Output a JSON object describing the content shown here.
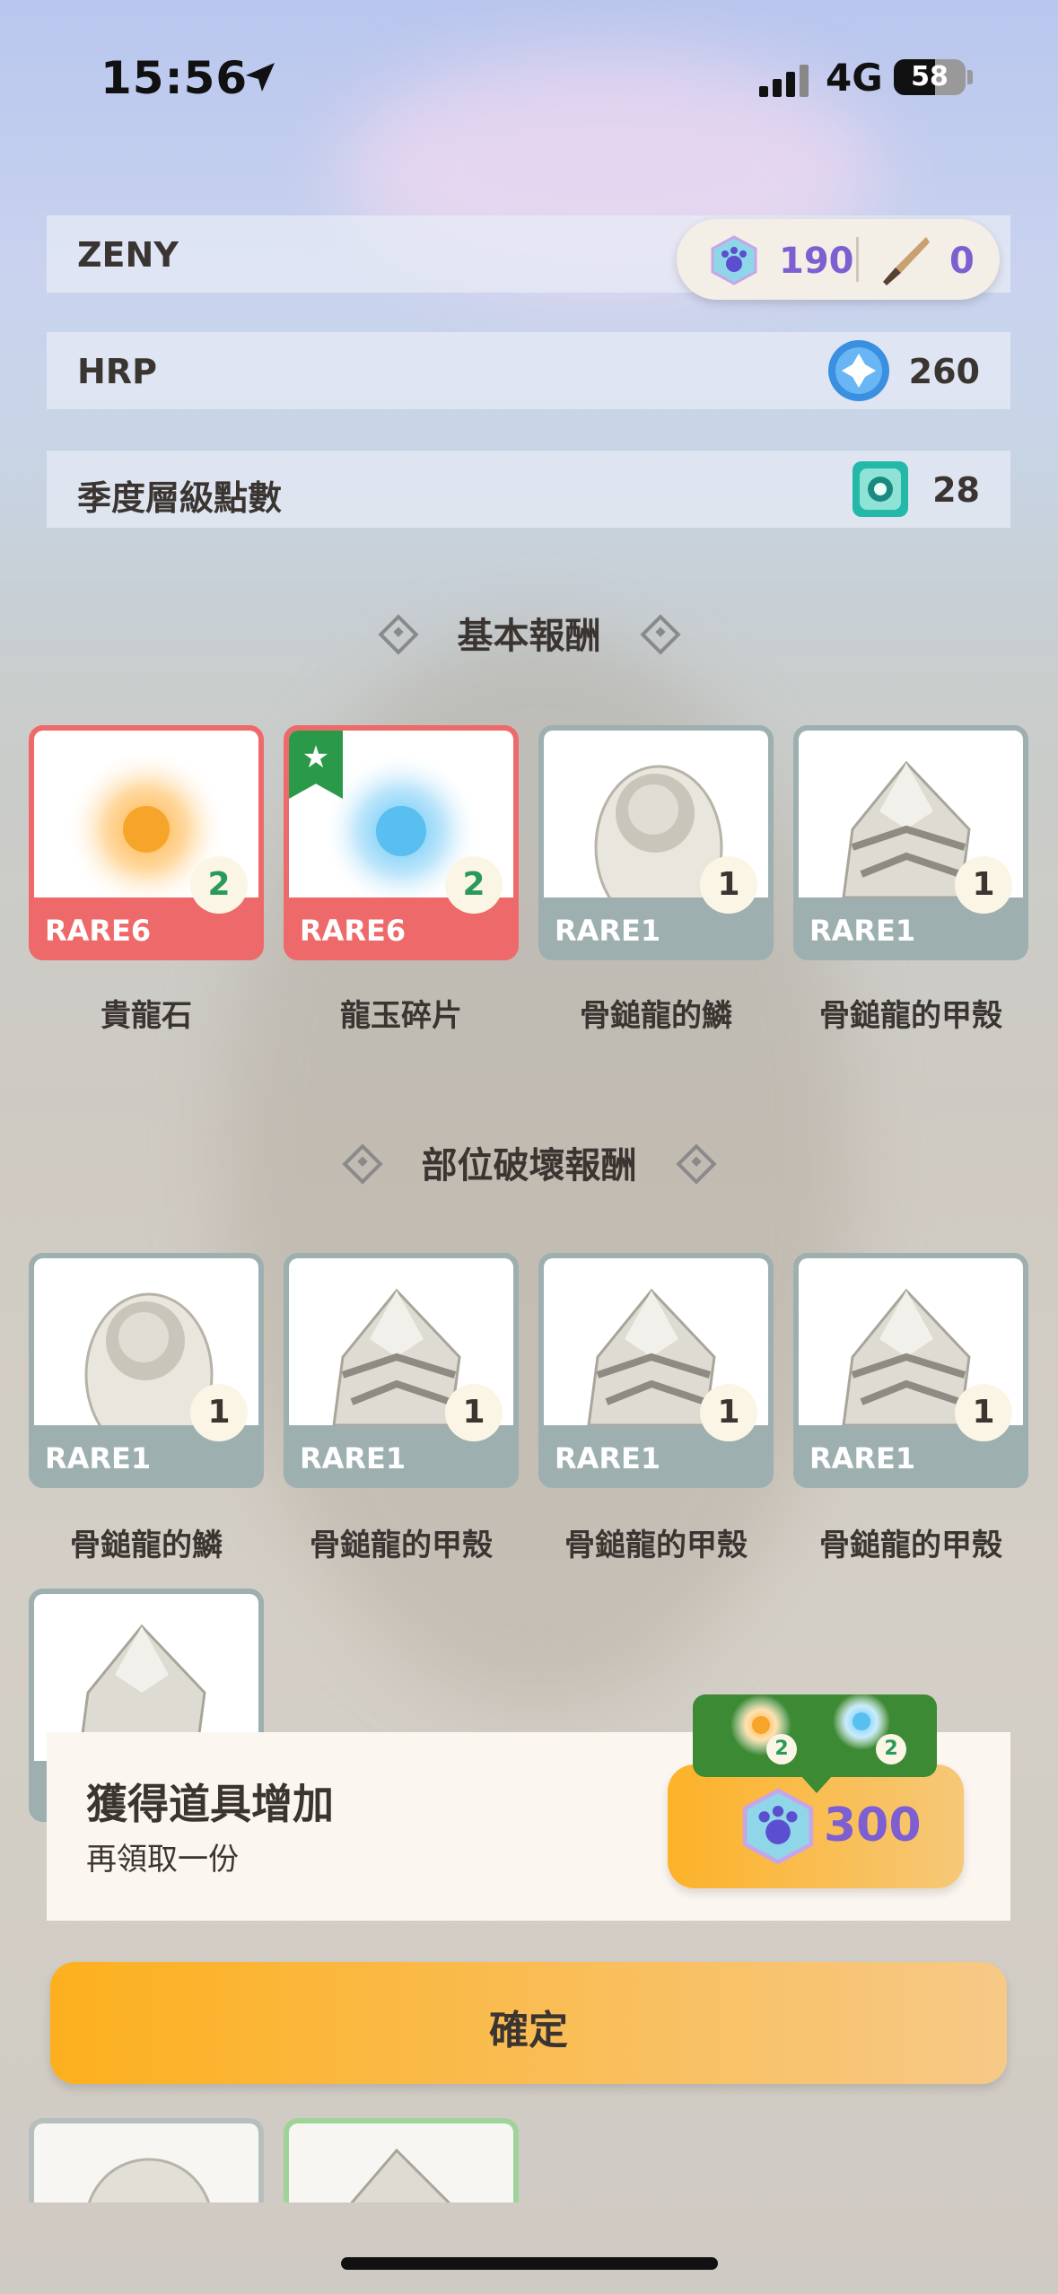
{
  "status_bar": {
    "time": "15:56",
    "network": "4G",
    "battery": "58"
  },
  "currencies": {
    "zeny": {
      "label": "ZENY"
    },
    "hrp": {
      "label": "HRP",
      "value": "260",
      "icon": "hrp-orb-icon"
    },
    "season": {
      "label": "季度層級點數",
      "value": "28",
      "icon": "season-emblem-icon"
    }
  },
  "wallet": {
    "gem_count": "190",
    "ticket_count": "0",
    "gem_icon": "paw-gem-icon",
    "ticket_icon": "knife-ticket-icon"
  },
  "sections": {
    "basic": "基本報酬",
    "parts": "部位破壞報酬"
  },
  "basic_rewards": [
    {
      "rarity": "RARE6",
      "count": "2",
      "name": "貴龍石",
      "icon": "golden-sun-gem-icon",
      "starred": false
    },
    {
      "rarity": "RARE6",
      "count": "2",
      "name": "龍玉碎片",
      "icon": "blue-star-gem-icon",
      "starred": true
    },
    {
      "rarity": "RARE1",
      "count": "1",
      "name": "骨鎚龍的鱗",
      "icon": "bone-scale-icon",
      "starred": false
    },
    {
      "rarity": "RARE1",
      "count": "1",
      "name": "骨鎚龍的甲殼",
      "icon": "bone-shell-icon",
      "starred": false
    }
  ],
  "part_rewards": [
    {
      "rarity": "RARE1",
      "count": "1",
      "name": "骨鎚龍的鱗",
      "icon": "bone-scale-icon"
    },
    {
      "rarity": "RARE1",
      "count": "1",
      "name": "骨鎚龍的甲殼",
      "icon": "bone-shell-icon"
    },
    {
      "rarity": "RARE1",
      "count": "1",
      "name": "骨鎚龍的甲殼",
      "icon": "bone-shell-icon"
    },
    {
      "rarity": "RARE1",
      "count": "1",
      "name": "骨鎚龍的甲殼",
      "icon": "bone-shell-icon"
    }
  ],
  "popup": {
    "title": "獲得道具增加",
    "subtitle": "再領取一份",
    "cost": "300",
    "bonus_counts": [
      "2",
      "2"
    ]
  },
  "confirm_label": "確定",
  "colors": {
    "rare6": "#ee6a6a",
    "rare1": "#9eafb0",
    "accent_purple": "#7d5fd1",
    "button_orange": "#fdb01e"
  }
}
